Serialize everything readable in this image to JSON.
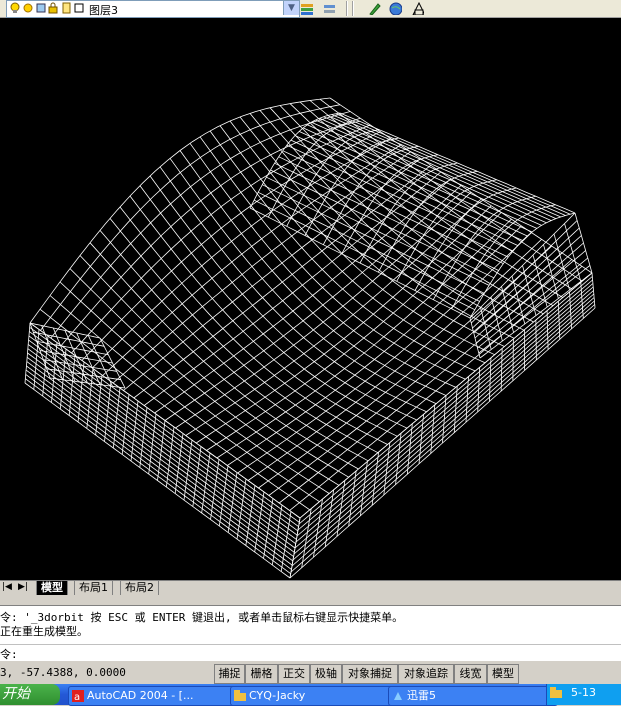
{
  "toolbar": {
    "layer_name": "图层3",
    "icons": [
      "lightbulb-icon",
      "sun-icon",
      "lock-icon",
      "color-swatch-icon",
      "layer-manager-icon",
      "layer-previous-icon",
      "properties-icon",
      "globe-icon",
      "text-style-icon"
    ]
  },
  "viewport": {
    "background": "#000000",
    "mesh_color": "#ffffff",
    "object": "wireframe-3d-mesh"
  },
  "tabs": {
    "nav": [
      "|◀",
      "▶|"
    ],
    "items": [
      "模型",
      "布局1",
      "布局2"
    ]
  },
  "command": {
    "history": [
      "令: '_3dorbit 按 ESC 或 ENTER 键退出, 或者单击鼠标右键显示快捷菜单。",
      "正在重生成模型。"
    ],
    "prompt": "令:"
  },
  "status": {
    "coords": "3,  -57.4388, 0.0000",
    "buttons": [
      "捕捉",
      "栅格",
      "正交",
      "极轴",
      "对象捕捉",
      "对象追踪",
      "线宽",
      "模型"
    ]
  },
  "taskbar": {
    "start": "开始",
    "tasks": [
      "AutoCAD 2004 - [...",
      "CYQ-Jacky",
      "迅雷5",
      "5-13"
    ]
  }
}
